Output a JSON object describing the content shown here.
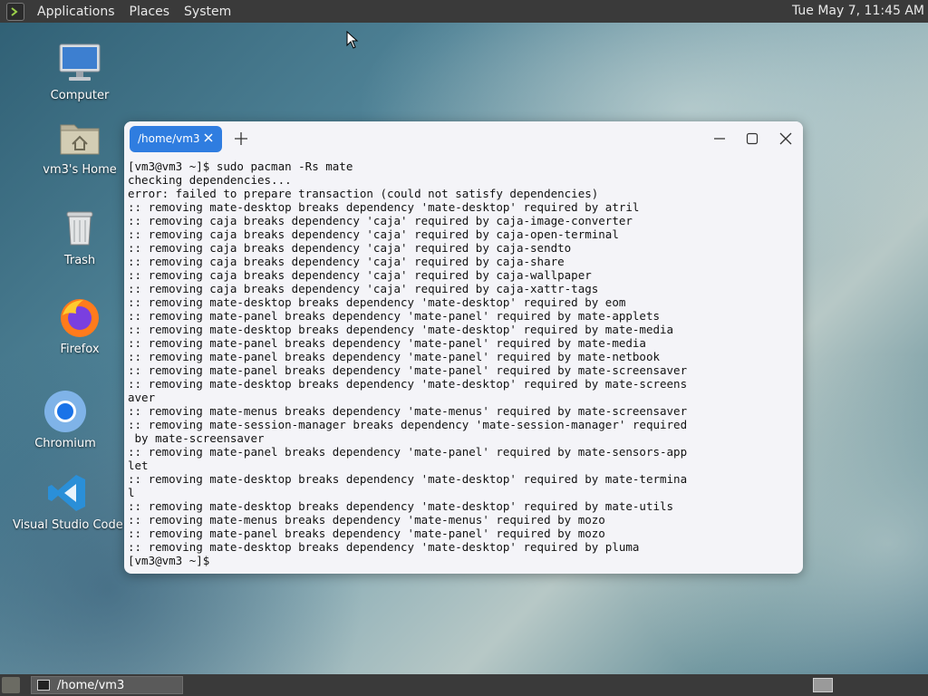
{
  "top_panel": {
    "menus": [
      "Applications",
      "Places",
      "System"
    ],
    "clock": "Tue May  7, 11:45 AM"
  },
  "desktop_icons": [
    {
      "label": "Computer",
      "icon": "computer-icon"
    },
    {
      "label": "vm3's Home",
      "icon": "home-folder-icon"
    },
    {
      "label": "Trash",
      "icon": "trash-icon"
    },
    {
      "label": "Firefox",
      "icon": "firefox-icon"
    },
    {
      "label": "Chromium",
      "icon": "chromium-icon"
    },
    {
      "label": "Visual Studio Code",
      "icon": "vscode-icon"
    }
  ],
  "terminal": {
    "tab_title": "/home/vm3",
    "lines": [
      "[vm3@vm3 ~]$ sudo pacman -Rs mate",
      "checking dependencies...",
      "error: failed to prepare transaction (could not satisfy dependencies)",
      ":: removing mate-desktop breaks dependency 'mate-desktop' required by atril",
      ":: removing caja breaks dependency 'caja' required by caja-image-converter",
      ":: removing caja breaks dependency 'caja' required by caja-open-terminal",
      ":: removing caja breaks dependency 'caja' required by caja-sendto",
      ":: removing caja breaks dependency 'caja' required by caja-share",
      ":: removing caja breaks dependency 'caja' required by caja-wallpaper",
      ":: removing caja breaks dependency 'caja' required by caja-xattr-tags",
      ":: removing mate-desktop breaks dependency 'mate-desktop' required by eom",
      ":: removing mate-panel breaks dependency 'mate-panel' required by mate-applets",
      ":: removing mate-desktop breaks dependency 'mate-desktop' required by mate-media",
      ":: removing mate-panel breaks dependency 'mate-panel' required by mate-media",
      ":: removing mate-panel breaks dependency 'mate-panel' required by mate-netbook",
      ":: removing mate-panel breaks dependency 'mate-panel' required by mate-screensaver",
      ":: removing mate-desktop breaks dependency 'mate-desktop' required by mate-screens",
      "aver",
      ":: removing mate-menus breaks dependency 'mate-menus' required by mate-screensaver",
      ":: removing mate-session-manager breaks dependency 'mate-session-manager' required",
      " by mate-screensaver",
      ":: removing mate-panel breaks dependency 'mate-panel' required by mate-sensors-app",
      "let",
      ":: removing mate-desktop breaks dependency 'mate-desktop' required by mate-termina",
      "l",
      ":: removing mate-desktop breaks dependency 'mate-desktop' required by mate-utils",
      ":: removing mate-menus breaks dependency 'mate-menus' required by mozo",
      ":: removing mate-panel breaks dependency 'mate-panel' required by mozo",
      ":: removing mate-desktop breaks dependency 'mate-desktop' required by pluma",
      "[vm3@vm3 ~]$"
    ]
  },
  "bottom_panel": {
    "task_label": "/home/vm3"
  },
  "colors": {
    "panel_bg": "#3a3a3a",
    "tab_accent": "#2f7de0",
    "terminal_bg": "#f4f4f8"
  }
}
